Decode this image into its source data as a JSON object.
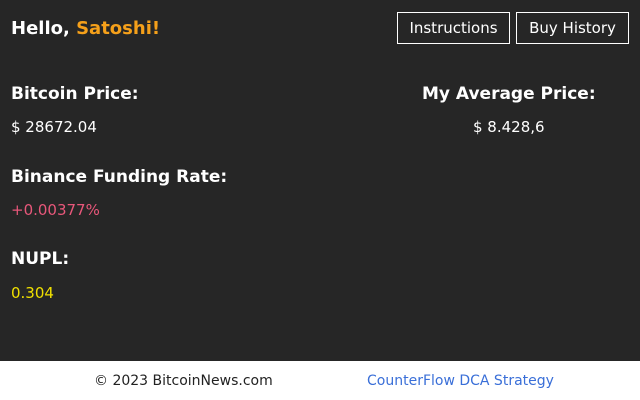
{
  "header": {
    "greeting_prefix": "Hello, ",
    "user_name": "Satoshi!",
    "instructions_label": "Instructions",
    "buy_history_label": "Buy History"
  },
  "metrics": {
    "bitcoin_price_label": "Bitcoin Price:",
    "bitcoin_price_value": "$ 28672.04",
    "avg_price_label": "My Average Price:",
    "avg_price_value": "$ 8.428,6",
    "funding_rate_label": "Binance Funding Rate:",
    "funding_rate_value": "+0.00377%",
    "nupl_label": "NUPL:",
    "nupl_value": "0.304"
  },
  "footer": {
    "copyright": "© 2023 BitcoinNews.com",
    "strategy_link": "CounterFlow DCA Strategy"
  },
  "colors": {
    "panel_background": "#262626",
    "user_name": "#f5a01a",
    "funding_rate": "#e8577a",
    "nupl": "#f0e000",
    "link": "#3a6fd8"
  }
}
